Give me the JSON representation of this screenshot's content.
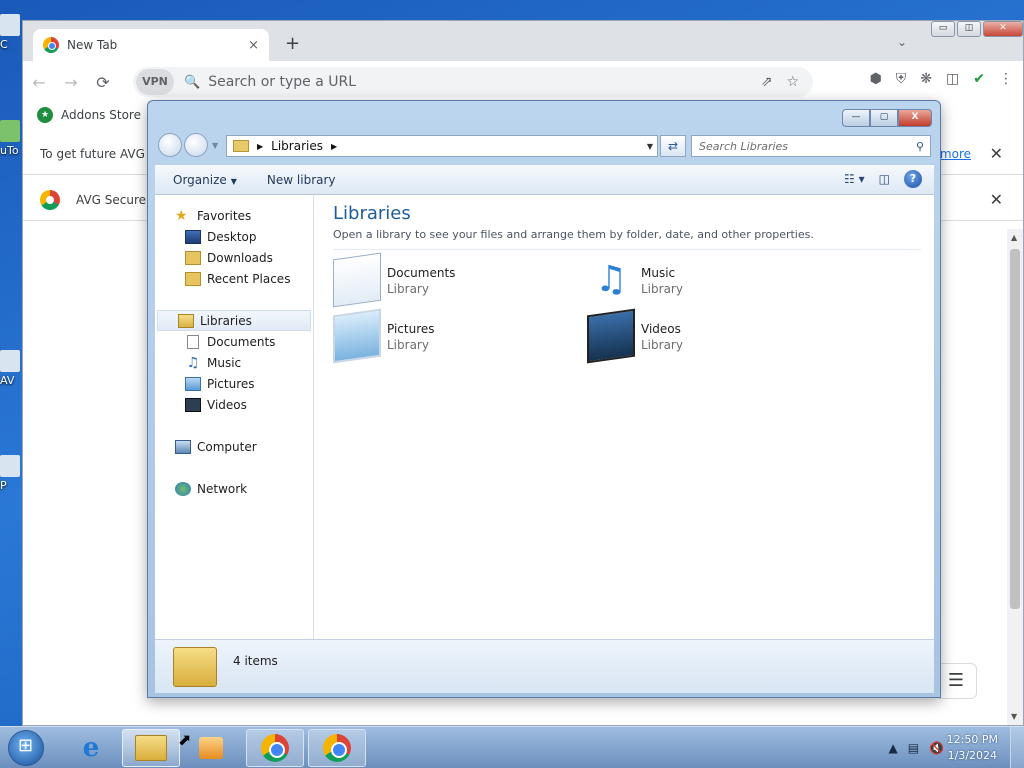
{
  "desktop": {
    "icons": [
      {
        "label": "C"
      },
      {
        "label": "uTo"
      },
      {
        "label": "AV"
      },
      {
        "label": "P"
      }
    ]
  },
  "chrome": {
    "tab": {
      "title": "New Tab",
      "favicon": "chrome-icon",
      "close": "×"
    },
    "new_tab": "+",
    "tab_search": "⌄",
    "window_controls": {
      "minimize": "▭",
      "restore": "◫",
      "close": "✕"
    },
    "toolbar": {
      "back": "←",
      "forward": "→",
      "reload": "⟳",
      "vpn_label": "VPN",
      "omnibox_placeholder": "Search or type a URL",
      "share_icon": "share-icon",
      "bookmark_icon": "star-icon"
    },
    "bookmarks": [
      {
        "label": "Addons Store"
      }
    ],
    "infobars": [
      {
        "text": "To get future AVG S",
        "link": "more",
        "close": "✕"
      },
      {
        "text": "AVG Secure",
        "close": "✕"
      }
    ]
  },
  "explorer": {
    "window_controls": {
      "minimize": "—",
      "maximize": "▢",
      "close": "X"
    },
    "address": {
      "crumbs": [
        "Libraries"
      ]
    },
    "search_placeholder": "Search Libraries",
    "commands": {
      "organize": "Organize",
      "new_library": "New library"
    },
    "nav": {
      "favorites": {
        "label": "Favorites",
        "items": [
          "Desktop",
          "Downloads",
          "Recent Places"
        ]
      },
      "libraries": {
        "label": "Libraries",
        "items": [
          "Documents",
          "Music",
          "Pictures",
          "Videos"
        ]
      },
      "computer": "Computer",
      "network": "Network"
    },
    "content": {
      "title": "Libraries",
      "description": "Open a library to see your files and arrange them by folder, date, and other properties.",
      "tiles": [
        {
          "name": "Documents",
          "type": "Library",
          "icon": "documents-library-icon"
        },
        {
          "name": "Music",
          "type": "Library",
          "icon": "music-library-icon"
        },
        {
          "name": "Pictures",
          "type": "Library",
          "icon": "pictures-library-icon"
        },
        {
          "name": "Videos",
          "type": "Library",
          "icon": "videos-library-icon"
        }
      ]
    },
    "status": {
      "count_text": "4 items"
    }
  },
  "taskbar": {
    "clock": {
      "time": "12:50 PM",
      "date": "1/3/2024"
    },
    "tray_icons": [
      "show-hidden-icon",
      "network-icon",
      "volume-muted-icon"
    ]
  },
  "colors": {
    "explorer_title_blue": "#1e5c9a",
    "chrome_link": "#1a73e8",
    "avg_green": "#1a9a3c"
  }
}
